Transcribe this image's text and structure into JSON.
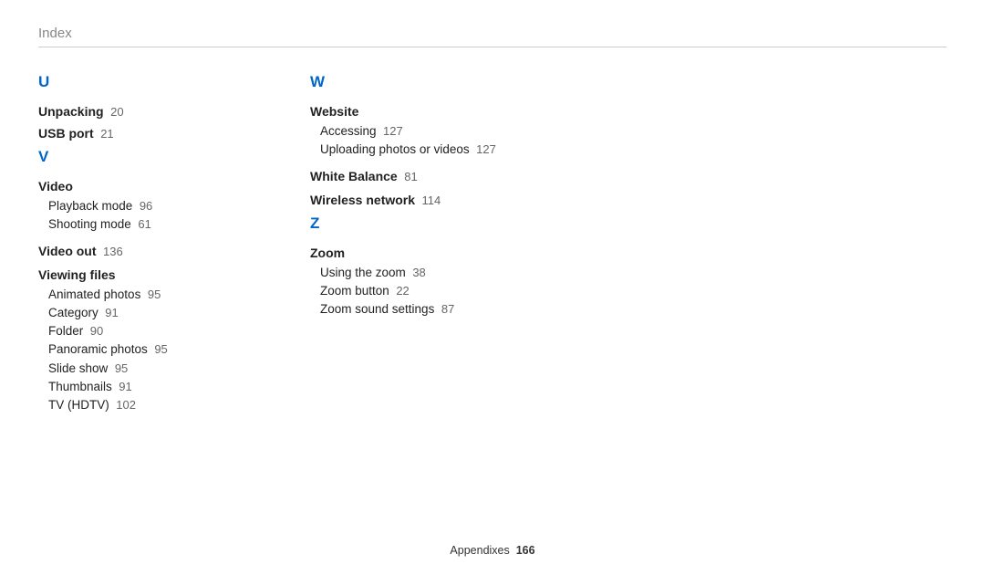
{
  "header": {
    "title": "Index"
  },
  "col1": {
    "letter_u": "U",
    "unpacking_label": "Unpacking",
    "unpacking_page": "20",
    "usb_label": "USB port",
    "usb_page": "21",
    "letter_v": "V",
    "video_label": "Video",
    "video_sub": [
      {
        "label": "Playback mode",
        "page": "96"
      },
      {
        "label": "Shooting mode",
        "page": "61"
      }
    ],
    "video_out_label": "Video out",
    "video_out_page": "136",
    "viewing_label": "Viewing files",
    "viewing_sub": [
      {
        "label": "Animated photos",
        "page": "95"
      },
      {
        "label": "Category",
        "page": "91"
      },
      {
        "label": "Folder",
        "page": "90"
      },
      {
        "label": "Panoramic photos",
        "page": "95"
      },
      {
        "label": "Slide show",
        "page": "95"
      },
      {
        "label": "Thumbnails",
        "page": "91"
      },
      {
        "label": "TV (HDTV)",
        "page": "102"
      }
    ]
  },
  "col2": {
    "letter_w": "W",
    "website_label": "Website",
    "website_sub": [
      {
        "label": "Accessing",
        "page": "127"
      },
      {
        "label": "Uploading photos or videos",
        "page": "127"
      }
    ],
    "wb_label": "White Balance",
    "wb_page": "81",
    "wn_label": "Wireless network",
    "wn_page": "114",
    "letter_z": "Z",
    "zoom_label": "Zoom",
    "zoom_sub": [
      {
        "label": "Using the zoom",
        "page": "38"
      },
      {
        "label": "Zoom button",
        "page": "22"
      },
      {
        "label": "Zoom sound settings",
        "page": "87"
      }
    ]
  },
  "footer": {
    "section": "Appendixes",
    "page": "166"
  }
}
